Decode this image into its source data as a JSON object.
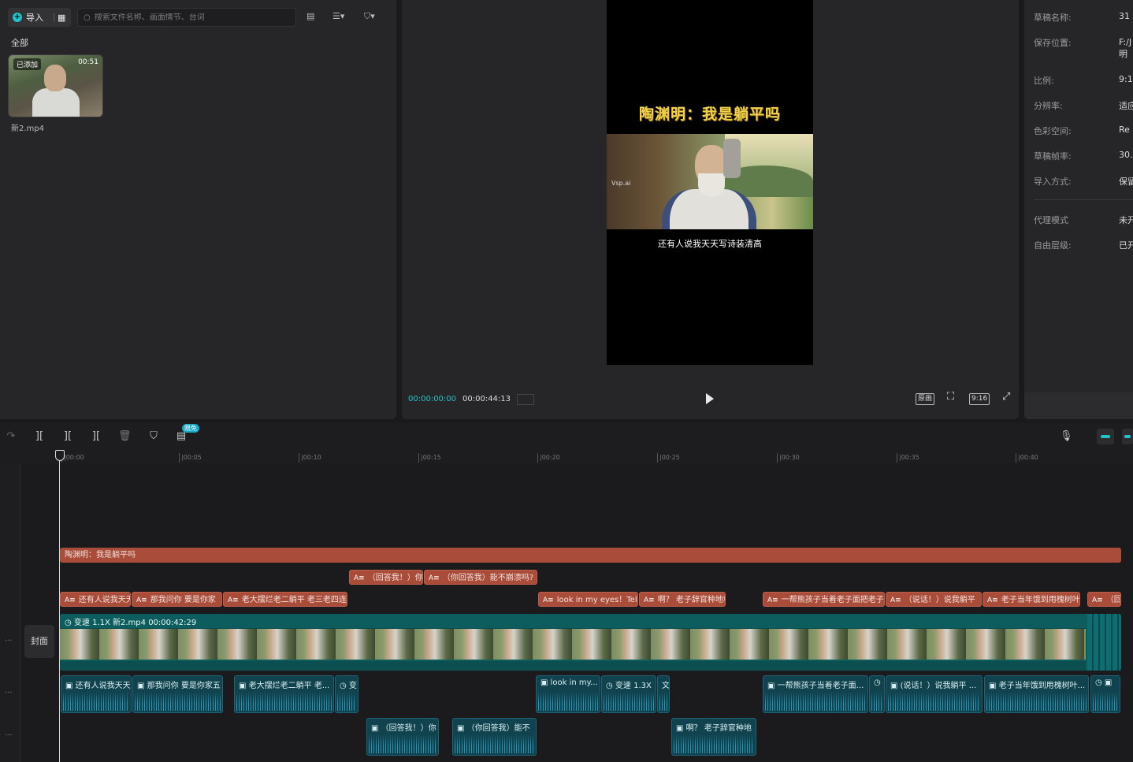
{
  "media": {
    "import_label": "导入",
    "search_placeholder": "搜索文件名称、画面情节、台词",
    "all_label": "全部",
    "item": {
      "badge": "已添加",
      "duration": "00:51",
      "filename": "新2.mp4"
    }
  },
  "player": {
    "video_title": "陶渊明：我是躺平吗",
    "subtitle": "还有人说我天天写诗装清高",
    "watermark": "Vsp.ai",
    "time_current": "00:00:00:00",
    "time_total": "00:00:44:13",
    "btn_original": "原画",
    "btn_ratio": "9:16"
  },
  "details": {
    "rows": [
      {
        "label": "草稿名称:",
        "value": "31"
      },
      {
        "label": "保存位置:",
        "value": "F:/J 明"
      },
      {
        "label": "比例:",
        "value": "9:1"
      },
      {
        "label": "分辨率:",
        "value": "适应"
      },
      {
        "label": "色彩空间:",
        "value": "Re"
      },
      {
        "label": "草稿帧率:",
        "value": "30."
      },
      {
        "label": "导入方式:",
        "value": "保留"
      },
      {
        "label": "代理模式",
        "value": "未开"
      },
      {
        "label": "自由层级:",
        "value": "已开"
      }
    ]
  },
  "toolbar": {
    "badge": "限免"
  },
  "ruler": {
    "ticks": [
      "|00:00",
      "|00:05",
      "|00:10",
      "|00:15",
      "|00:20",
      "|00:25",
      "|00:30",
      "|00:35",
      "|00:40"
    ]
  },
  "timeline": {
    "cover_label": "封面",
    "title_clip": "陶渊明：我是躺平吗",
    "text_row1": [
      "（回答我！）你",
      "（你回答我）能不崩溃吗?"
    ],
    "text_row2": [
      "还有人说我天天",
      "那我问你 要是你家",
      "老大摆烂老二躺平 老三老四连",
      "look in my eyes！Tell",
      "啊？ 老子辞官种地种",
      "一帮熊孩子当着老子面把老子",
      "（说话！）说我躺平 ",
      "老子当年饿到用槐树叶",
      "（回"
    ],
    "video_label": "变速 1.1X   新2.mp4   00:00:42:29",
    "audio_row1": [
      "还有人说我天天",
      "那我问你 要是你家五",
      "老大摆烂老二躺平 老...",
      "变",
      "look in my...",
      "变速 1.3X",
      "文",
      "一帮熊孩子当着老子面...",
      "(说话！）说我躺平 ...",
      "老子当年饿到用槐树叶..."
    ],
    "audio_row2": [
      "（回答我！）你",
      "（你回答我）能不",
      "啊？ 老子辞官种地"
    ]
  }
}
